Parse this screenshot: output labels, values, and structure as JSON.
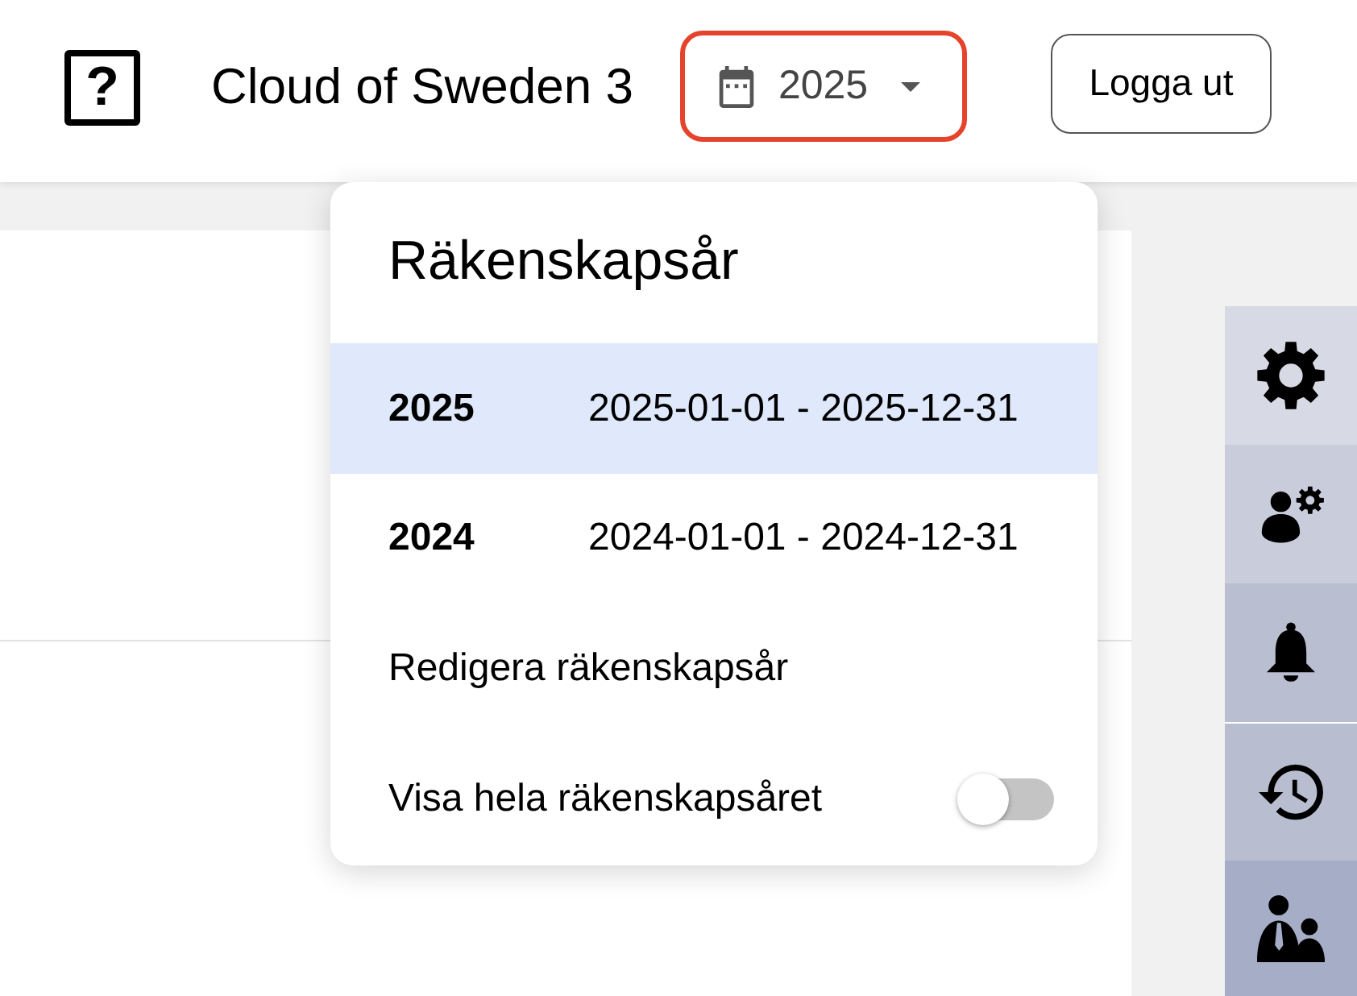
{
  "header": {
    "logo": "?",
    "title": "Cloud of Sweden 3",
    "year_selector": {
      "value": "2025",
      "expanded": true
    },
    "logout_button": "Logga ut"
  },
  "fiscal_year_menu": {
    "title": "Räkenskapsår",
    "years": [
      {
        "year": "2025",
        "period": "2025-01-01 - 2025-12-31",
        "selected": true
      },
      {
        "year": "2024",
        "period": "2024-01-01 - 2024-12-31",
        "selected": false
      }
    ],
    "edit_item": "Redigera räkenskapsår",
    "full_year_toggle": {
      "label": "Visa hela räkenskapsåret",
      "on": false
    }
  }
}
